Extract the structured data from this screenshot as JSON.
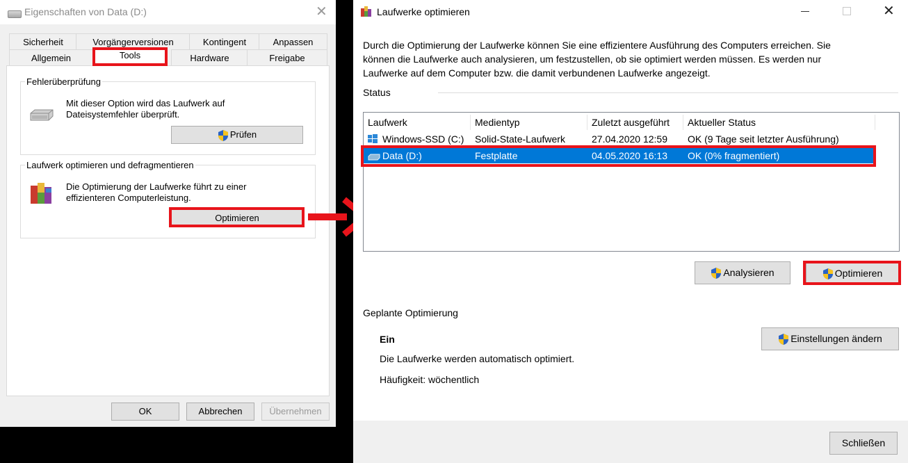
{
  "left_dialog": {
    "title": "Eigenschaften von Data (D:)",
    "tabs_row1": [
      "Sicherheit",
      "Vorgängerversionen",
      "Kontingent",
      "Anpassen"
    ],
    "tabs_row2": [
      "Allgemein",
      "Tools",
      "Hardware",
      "Freigabe"
    ],
    "active_tab": "Tools",
    "error_check": {
      "title": "Fehlerüberprüfung",
      "text1": "Mit dieser Option wird das Laufwerk auf",
      "text2": "Dateisystemfehler überprüft.",
      "button": "Prüfen"
    },
    "optimize": {
      "title": "Laufwerk optimieren und defragmentieren",
      "text1": "Die Optimierung der Laufwerke führt zu einer",
      "text2": "effizienteren Computerleistung.",
      "button": "Optimieren"
    },
    "buttons": {
      "ok": "OK",
      "cancel": "Abbrechen",
      "apply": "Übernehmen"
    }
  },
  "right_window": {
    "title": "Laufwerke optimieren",
    "description": [
      "Durch die Optimierung der Laufwerke können Sie eine effizientere Ausführung des Computers erreichen. Sie",
      "können die Laufwerke auch analysieren, um festzustellen, ob sie optimiert werden müssen. Es werden nur",
      "Laufwerke auf dem Computer bzw. die damit verbundenen Laufwerke angezeigt."
    ],
    "status_label": "Status",
    "columns": [
      "Laufwerk",
      "Medientyp",
      "Zuletzt ausgeführt",
      "Aktueller Status"
    ],
    "rows": [
      {
        "drive": "Windows-SSD (C:)",
        "media": "Solid-State-Laufwerk",
        "last_run": "27.04.2020 12:59",
        "status": "OK (9 Tage seit letzter Ausführung)",
        "selected": false
      },
      {
        "drive": "Data (D:)",
        "media": "Festplatte",
        "last_run": "04.05.2020 16:13",
        "status": "OK (0% fragmentiert)",
        "selected": true
      }
    ],
    "analyze_button": "Analysieren",
    "optimize_button": "Optimieren",
    "scheduled": {
      "label": "Geplante Optimierung",
      "state": "Ein",
      "text": "Die Laufwerke werden automatisch optimiert.",
      "frequency": "Häufigkeit: wöchentlich",
      "settings_button": "Einstellungen ändern"
    },
    "close_button": "Schließen"
  },
  "colors": {
    "highlight": "#e8141b",
    "selection": "#0078d7"
  }
}
